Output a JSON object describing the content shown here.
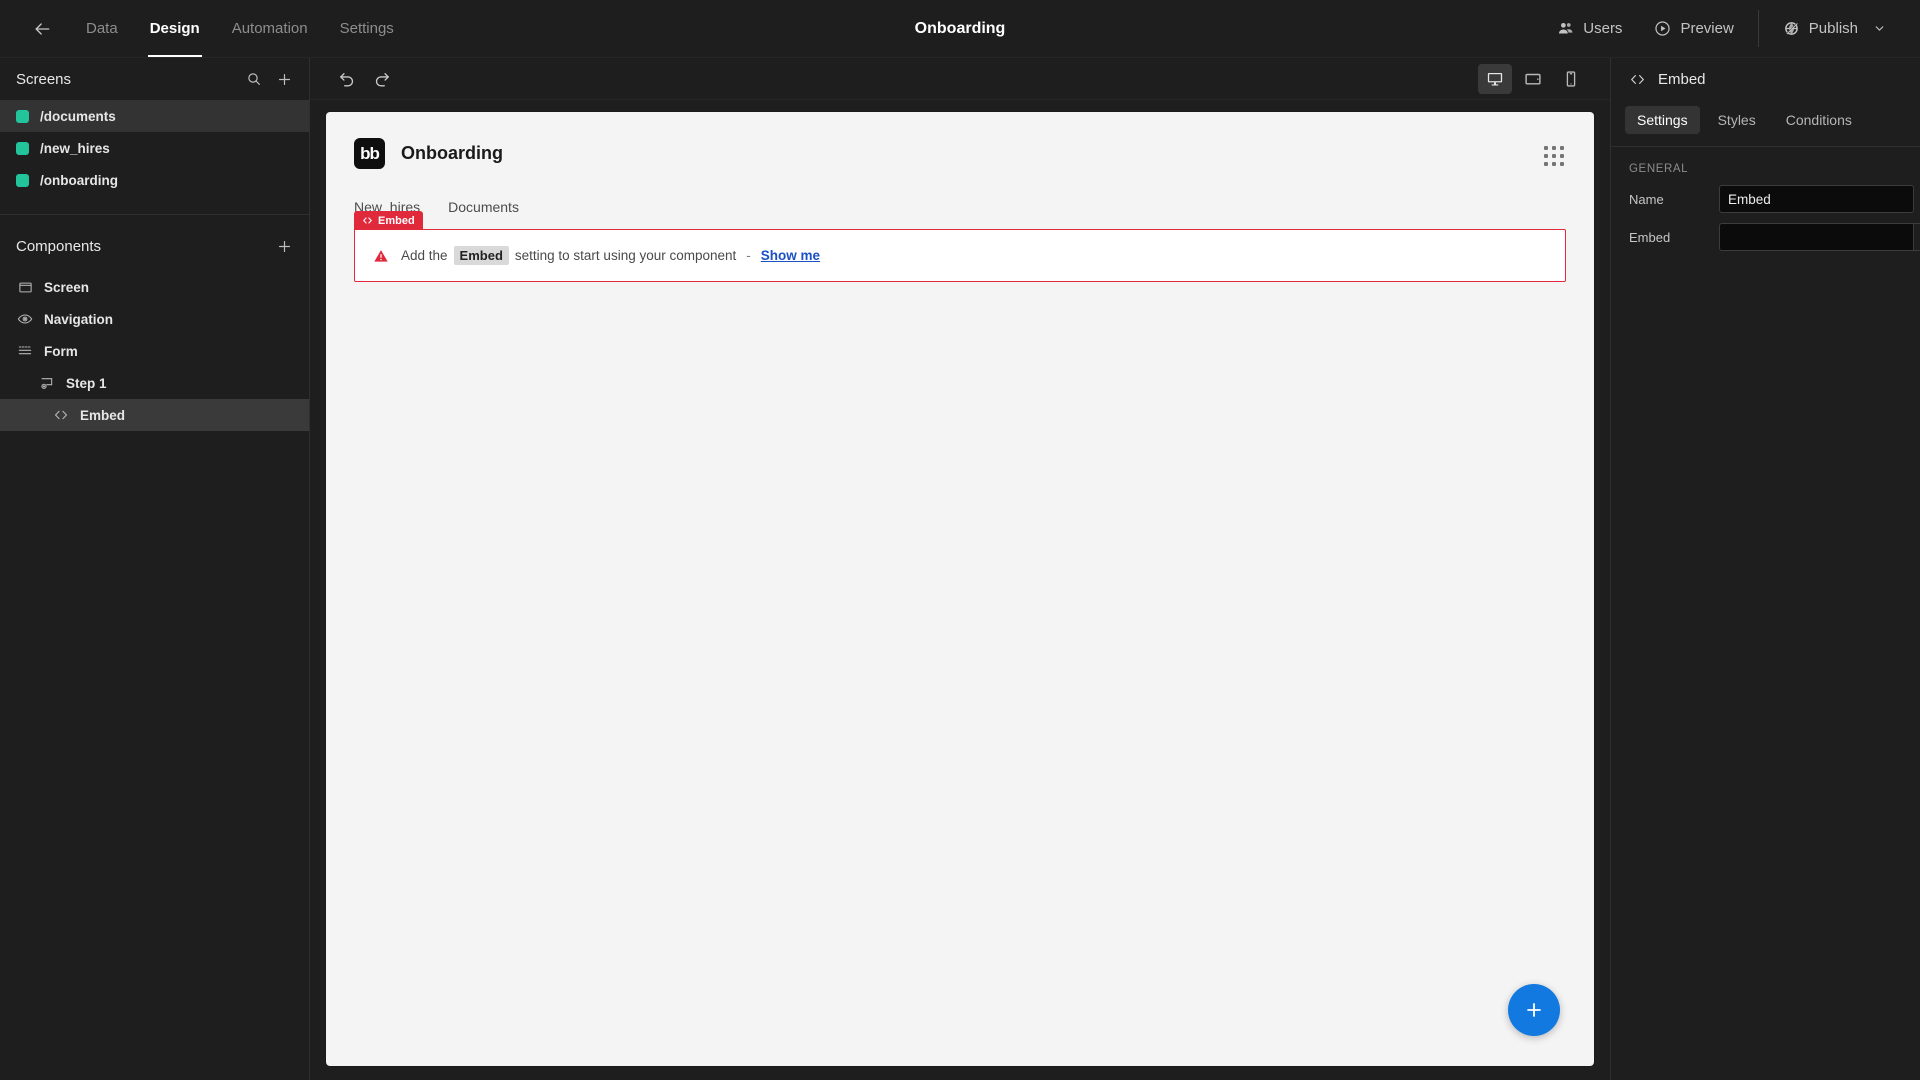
{
  "topbar": {
    "back_icon": "arrow-left-icon",
    "nav_tabs": [
      {
        "label": "Data",
        "active": false
      },
      {
        "label": "Design",
        "active": true
      },
      {
        "label": "Automation",
        "active": false
      },
      {
        "label": "Settings",
        "active": false
      }
    ],
    "app_title": "Onboarding",
    "users_label": "Users",
    "preview_label": "Preview",
    "publish_label": "Publish"
  },
  "left_panel": {
    "screens": {
      "title": "Screens",
      "search_icon": "search-icon",
      "add_icon": "plus-icon",
      "items": [
        {
          "label": "/documents",
          "selected": true,
          "color": "#21c49b"
        },
        {
          "label": "/new_hires",
          "selected": false,
          "color": "#21c49b"
        },
        {
          "label": "/onboarding",
          "selected": false,
          "color": "#21c49b"
        }
      ]
    },
    "components": {
      "title": "Components",
      "add_icon": "plus-icon",
      "items": [
        {
          "label": "Screen",
          "icon": "screen-icon",
          "indent": 0,
          "selected": false
        },
        {
          "label": "Navigation",
          "icon": "eye-icon",
          "indent": 0,
          "selected": false
        },
        {
          "label": "Form",
          "icon": "form-icon",
          "indent": 0,
          "selected": false
        },
        {
          "label": "Step 1",
          "icon": "step-icon",
          "indent": 1,
          "selected": false
        },
        {
          "label": "Embed",
          "icon": "code-icon",
          "indent": 2,
          "selected": true
        }
      ]
    }
  },
  "canvas_toolbar": {
    "undo_icon": "undo-icon",
    "redo_icon": "redo-icon",
    "devices": [
      {
        "name": "desktop-icon",
        "active": true
      },
      {
        "name": "tablet-icon",
        "active": false
      },
      {
        "name": "mobile-icon",
        "active": false
      }
    ]
  },
  "preview": {
    "logo_text": "bb",
    "title": "Onboarding",
    "grid_icon": "grid-dots-icon",
    "tabs": [
      {
        "label": "New_hires"
      },
      {
        "label": "Documents"
      }
    ],
    "embed_tag_label": "Embed",
    "warning": {
      "icon": "warning-triangle-icon",
      "text_before": "Add the",
      "code": "Embed",
      "text_after": "setting to start using your component",
      "separator": "-",
      "link_label": "Show me"
    },
    "fab_label": "+",
    "fab_color": "#1179e0"
  },
  "right_panel": {
    "header_icon": "code-icon",
    "header_title": "Embed",
    "tabs": [
      {
        "label": "Settings",
        "active": true
      },
      {
        "label": "Styles",
        "active": false
      },
      {
        "label": "Conditions",
        "active": false
      }
    ],
    "section_label": "GENERAL",
    "fields": [
      {
        "label": "Name",
        "value": "Embed",
        "placeholder": "",
        "has_binding_button": false
      },
      {
        "label": "Embed",
        "value": "",
        "placeholder": "",
        "has_binding_button": true,
        "binding_icon": "lightning-bolt-icon"
      }
    ]
  },
  "colors": {
    "accent_green": "#21c49b",
    "error_red": "#e02a3c",
    "link_blue": "#1a51c4",
    "fab_blue": "#1179e0",
    "panel_bg": "#1e1e1e",
    "canvas_bg": "#f4f4f4"
  }
}
